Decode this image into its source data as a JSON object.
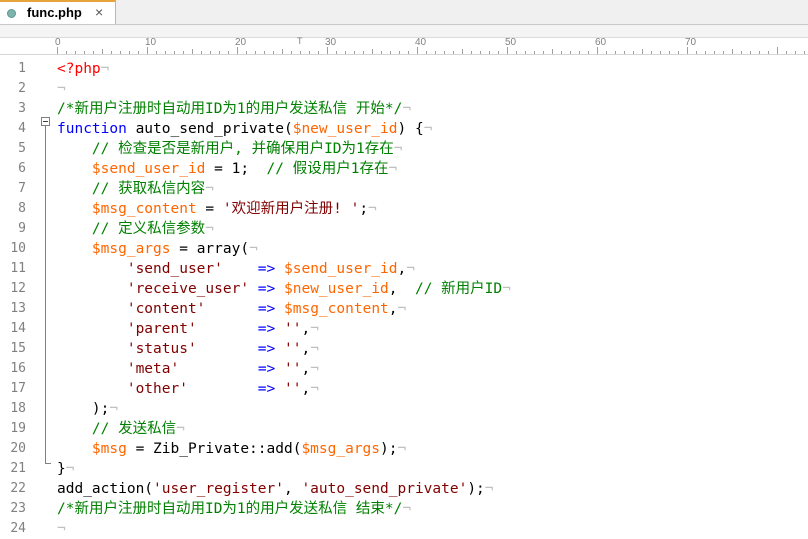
{
  "tab": {
    "filename": "func.php",
    "close": "×"
  },
  "ruler": {
    "marks": [
      "0",
      "10",
      "20",
      "30",
      "40",
      "50",
      "60",
      "70"
    ],
    "caret_marker": "T"
  },
  "line_numbers": [
    "1",
    "2",
    "3",
    "4",
    "5",
    "6",
    "7",
    "8",
    "9",
    "10",
    "11",
    "12",
    "13",
    "14",
    "15",
    "16",
    "17",
    "18",
    "19",
    "20",
    "21",
    "22",
    "23",
    "24"
  ],
  "eol_marker": "¬",
  "code": {
    "l1": [
      [
        "tag",
        "<?php"
      ]
    ],
    "l2": [],
    "l3": [
      [
        "cm",
        "/*新用户注册时自动用ID为1的用户发送私信 开始*/"
      ]
    ],
    "l4": [
      [
        "kw",
        "function"
      ],
      [
        "pl",
        " auto_send_private("
      ],
      [
        "var",
        "$new_user_id"
      ],
      [
        "pl",
        ") {"
      ]
    ],
    "l5": [
      [
        "pl",
        "    "
      ],
      [
        "cm",
        "// 检查是否是新用户, 并确保用户ID为1存在"
      ]
    ],
    "l6": [
      [
        "pl",
        "    "
      ],
      [
        "var",
        "$send_user_id"
      ],
      [
        "pl",
        " = 1;  "
      ],
      [
        "cm",
        "// 假设用户1存在"
      ]
    ],
    "l7": [
      [
        "pl",
        "    "
      ],
      [
        "cm",
        "// 获取私信内容"
      ]
    ],
    "l8": [
      [
        "pl",
        "    "
      ],
      [
        "var",
        "$msg_content"
      ],
      [
        "pl",
        " = "
      ],
      [
        "str",
        "'欢迎新用户注册! '"
      ],
      [
        "pl",
        ";"
      ]
    ],
    "l9": [
      [
        "pl",
        "    "
      ],
      [
        "cm",
        "// 定义私信参数"
      ]
    ],
    "l10": [
      [
        "pl",
        "    "
      ],
      [
        "var",
        "$msg_args"
      ],
      [
        "pl",
        " = array("
      ]
    ],
    "l11": [
      [
        "pl",
        "        "
      ],
      [
        "str",
        "'send_user'"
      ],
      [
        "pl",
        "    "
      ],
      [
        "kw",
        "=>"
      ],
      [
        "pl",
        " "
      ],
      [
        "var",
        "$send_user_id"
      ],
      [
        "pl",
        ","
      ]
    ],
    "l12": [
      [
        "pl",
        "        "
      ],
      [
        "str",
        "'receive_user'"
      ],
      [
        "pl",
        " "
      ],
      [
        "kw",
        "=>"
      ],
      [
        "pl",
        " "
      ],
      [
        "var",
        "$new_user_id"
      ],
      [
        "pl",
        ",  "
      ],
      [
        "cm",
        "// 新用户ID"
      ]
    ],
    "l13": [
      [
        "pl",
        "        "
      ],
      [
        "str",
        "'content'"
      ],
      [
        "pl",
        "      "
      ],
      [
        "kw",
        "=>"
      ],
      [
        "pl",
        " "
      ],
      [
        "var",
        "$msg_content"
      ],
      [
        "pl",
        ","
      ]
    ],
    "l14": [
      [
        "pl",
        "        "
      ],
      [
        "str",
        "'parent'"
      ],
      [
        "pl",
        "       "
      ],
      [
        "kw",
        "=>"
      ],
      [
        "pl",
        " "
      ],
      [
        "str",
        "''"
      ],
      [
        "pl",
        ","
      ]
    ],
    "l15": [
      [
        "pl",
        "        "
      ],
      [
        "str",
        "'status'"
      ],
      [
        "pl",
        "       "
      ],
      [
        "kw",
        "=>"
      ],
      [
        "pl",
        " "
      ],
      [
        "str",
        "''"
      ],
      [
        "pl",
        ","
      ]
    ],
    "l16": [
      [
        "pl",
        "        "
      ],
      [
        "str",
        "'meta'"
      ],
      [
        "pl",
        "         "
      ],
      [
        "kw",
        "=>"
      ],
      [
        "pl",
        " "
      ],
      [
        "str",
        "''"
      ],
      [
        "pl",
        ","
      ]
    ],
    "l17": [
      [
        "pl",
        "        "
      ],
      [
        "str",
        "'other'"
      ],
      [
        "pl",
        "        "
      ],
      [
        "kw",
        "=>"
      ],
      [
        "pl",
        " "
      ],
      [
        "str",
        "''"
      ],
      [
        "pl",
        ","
      ]
    ],
    "l18": [
      [
        "pl",
        "    );"
      ]
    ],
    "l19": [
      [
        "pl",
        "    "
      ],
      [
        "cm",
        "// 发送私信"
      ]
    ],
    "l20": [
      [
        "pl",
        "    "
      ],
      [
        "var",
        "$msg"
      ],
      [
        "pl",
        " = Zib_Private::add("
      ],
      [
        "var",
        "$msg_args"
      ],
      [
        "pl",
        ");"
      ]
    ],
    "l21": [
      [
        "pl",
        "}"
      ]
    ],
    "l22": [
      [
        "pl",
        "add_action("
      ],
      [
        "str",
        "'user_register'"
      ],
      [
        "pl",
        ", "
      ],
      [
        "str",
        "'auto_send_private'"
      ],
      [
        "pl",
        ");"
      ]
    ],
    "l23": [
      [
        "cm",
        "/*新用户注册时自动用ID为1的用户发送私信 结束*/"
      ]
    ],
    "l24": []
  },
  "colors": {
    "keyword": "#0000ff",
    "comment": "#008000",
    "variable": "#ff6600",
    "string": "#800000",
    "php_tag": "#ff0000",
    "line_number": "#808080"
  }
}
